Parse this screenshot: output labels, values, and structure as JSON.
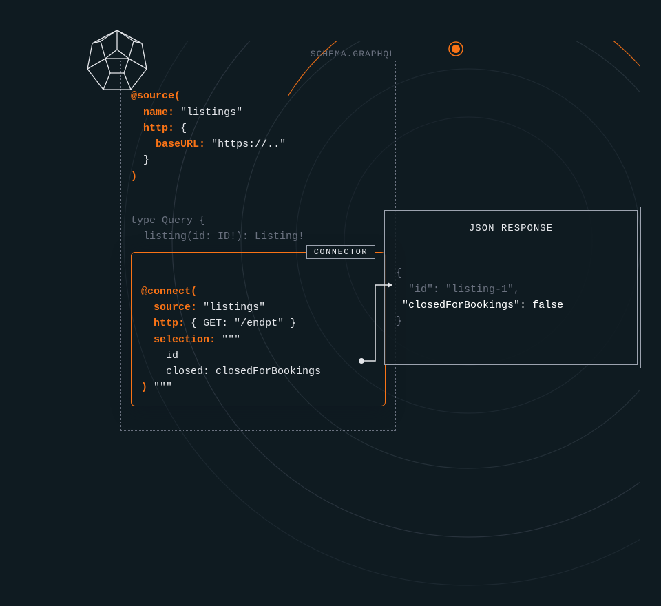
{
  "schema": {
    "label": "SCHEMA.GRAPHQL",
    "source_directive": {
      "at": "@source(",
      "name_key": "name",
      "name_val": "\"listings\"",
      "http_key": "http",
      "http_open": "{",
      "baseURL_key": "baseURL",
      "baseURL_val": "\"https://..\"",
      "http_close": "}",
      "close": ")"
    },
    "query": {
      "type_line": "type Query {",
      "field_line": "  listing(id: ID!): Listing!"
    }
  },
  "connector": {
    "badge": "CONNECTOR",
    "at": "@connect(",
    "source_key": "source",
    "source_val": "\"listings\"",
    "http_key": "http",
    "http_val": "{ GET: \"/endpt\" }",
    "selection_key": "selection",
    "selection_open": "\"\"\"",
    "sel_id": "    id",
    "sel_closed_key": "    closed",
    "sel_closed_val": " closedForBookings",
    "close_paren": ")",
    "close_quotes": "\"\"\""
  },
  "json": {
    "title": "JSON RESPONSE",
    "open": "{",
    "id_line": "  \"id\": \"listing-1\",",
    "highlight_key": "\"closedForBookings\"",
    "highlight_colon": ": ",
    "highlight_val": "false",
    "close": "}"
  },
  "colors": {
    "orange": "#f97316",
    "grey": "#6b7280",
    "white": "#e5e7eb",
    "bg": "#0f1b21"
  }
}
